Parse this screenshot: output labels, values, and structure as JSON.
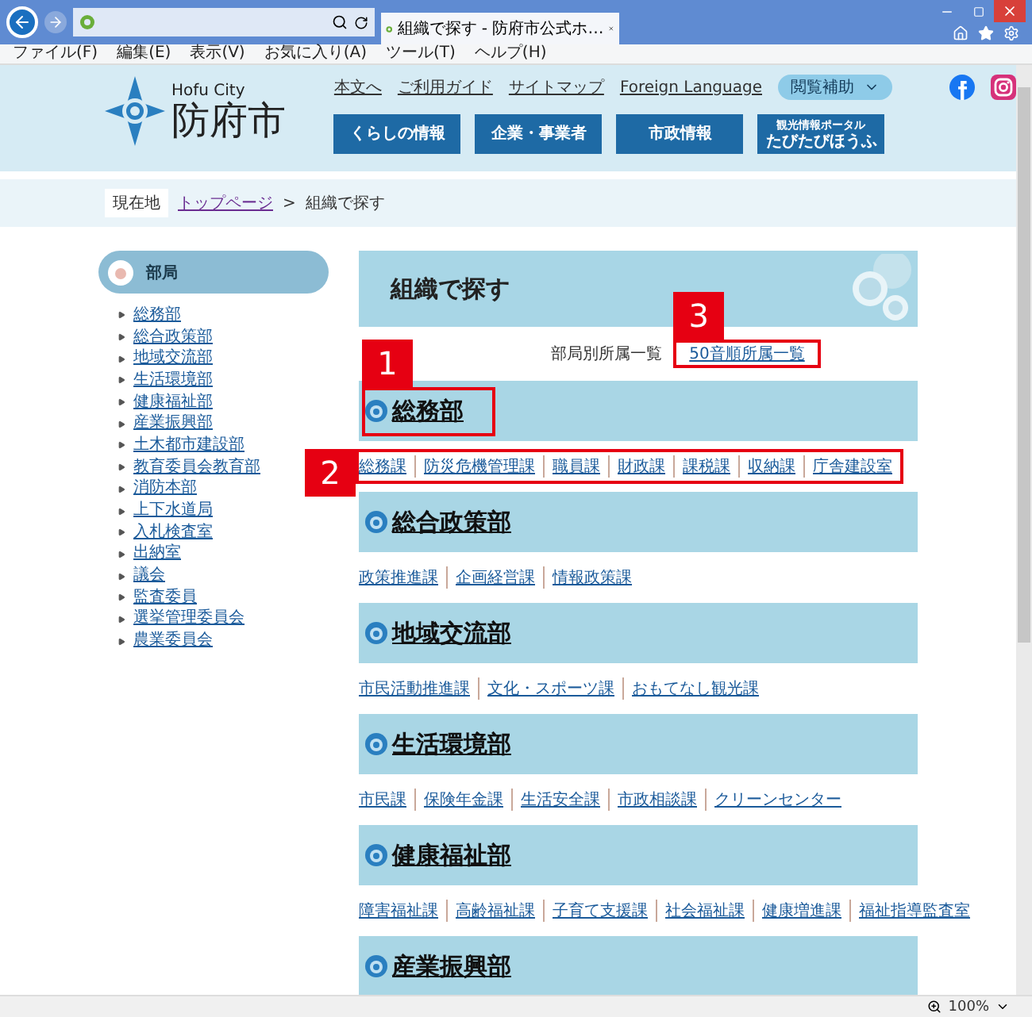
{
  "browser": {
    "tab_title": "組織で探す - 防府市公式ホ…",
    "menu": [
      "ファイル(F)",
      "編集(E)",
      "表示(V)",
      "お気に入り(A)",
      "ツール(T)",
      "ヘルプ(H)"
    ],
    "zoom": "100%"
  },
  "header": {
    "city_en": "Hofu City",
    "city": "防府市",
    "links": [
      "本文へ",
      "ご利用ガイド",
      "サイトマップ",
      "Foreign Language"
    ],
    "assist": "閲覧補助",
    "nav": [
      {
        "label": "くらしの情報"
      },
      {
        "label": "企業・事業者"
      },
      {
        "label": "市政情報"
      },
      {
        "kicker": "観光情報ポータル",
        "label": "たびたびほうふ"
      }
    ]
  },
  "breadcrumb": {
    "here": "現在地",
    "link": "トップページ",
    "separator": ">",
    "current": "組織で探す"
  },
  "sidebar": {
    "title": "部局",
    "items": [
      "総務部",
      "総合政策部",
      "地域交流部",
      "生活環境部",
      "健康福祉部",
      "産業振興部",
      "土木都市建設部",
      "教育委員会教育部",
      "消防本部",
      "上下水道局",
      "入札検査室",
      "出納室",
      "議会",
      "監査委員",
      "選挙管理委員会",
      "農業委員会"
    ]
  },
  "main": {
    "title": "組織で探す",
    "views": [
      {
        "label": "部局別所属一覧",
        "selected": true
      },
      {
        "label": "50音順所属一覧",
        "selected": false,
        "annotation": {
          "number": "3"
        }
      }
    ],
    "sections": [
      {
        "name": "総務部",
        "annotation": {
          "number": "1"
        },
        "links_annotation": {
          "number": "2"
        },
        "links": [
          "総務課",
          "防災危機管理課",
          "職員課",
          "財政課",
          "課税課",
          "収納課",
          "庁舎建設室"
        ]
      },
      {
        "name": "総合政策部",
        "links": [
          "政策推進課",
          "企画経営課",
          "情報政策課"
        ]
      },
      {
        "name": "地域交流部",
        "links": [
          "市民活動推進課",
          "文化・スポーツ課",
          "おもてなし観光課"
        ]
      },
      {
        "name": "生活環境部",
        "links": [
          "市民課",
          "保険年金課",
          "生活安全課",
          "市政相談課",
          "クリーンセンター"
        ]
      },
      {
        "name": "健康福祉部",
        "links": [
          "障害福祉課",
          "高齢福祉課",
          "子育て支援課",
          "社会福祉課",
          "健康増進課",
          "福祉指導監査室"
        ]
      },
      {
        "name": "産業振興部"
      }
    ]
  }
}
